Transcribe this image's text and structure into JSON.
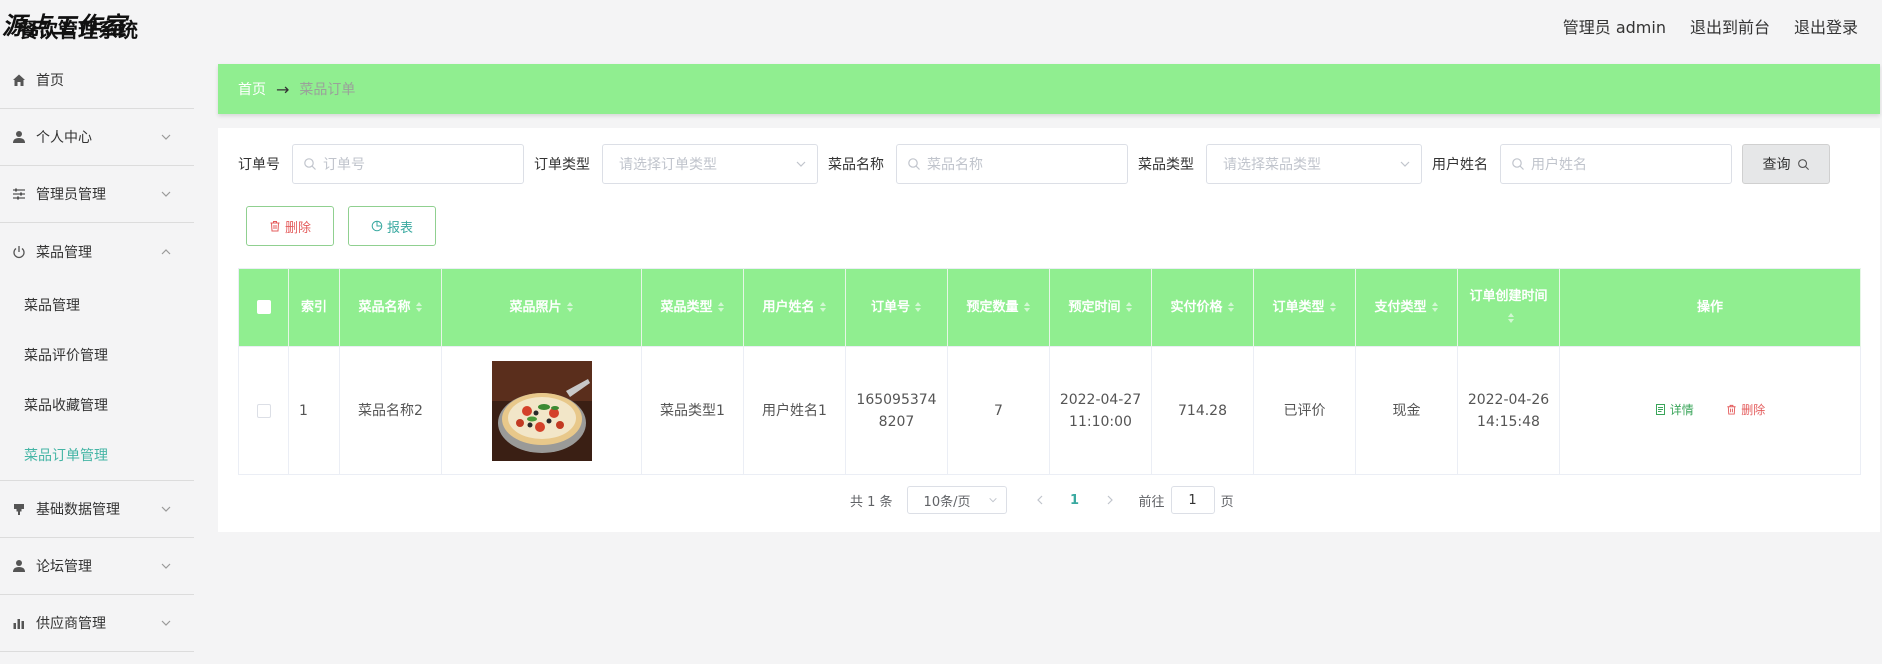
{
  "header": {
    "watermark": "源点工作室",
    "system_title": "餐饮管理系统",
    "user_label": "管理员 admin",
    "frontend_link": "退出到前台",
    "logout_link": "退出登录"
  },
  "sidebar": {
    "items": [
      {
        "label": "首页",
        "icon": "home-icon"
      },
      {
        "label": "个人中心",
        "icon": "user-icon"
      },
      {
        "label": "管理员管理",
        "icon": "sliders-icon"
      },
      {
        "label": "菜品管理",
        "icon": "power-icon"
      },
      {
        "label": "基础数据管理",
        "icon": "stamp-icon"
      },
      {
        "label": "论坛管理",
        "icon": "user-icon"
      },
      {
        "label": "供应商管理",
        "icon": "bar-chart-icon"
      }
    ],
    "sub_items": [
      "菜品管理",
      "菜品评价管理",
      "菜品收藏管理",
      "菜品订单管理"
    ],
    "active_sub": "菜品订单管理"
  },
  "breadcrumb": {
    "home": "首页",
    "arrow": "→",
    "current": "菜品订单"
  },
  "search": {
    "order_no_label": "订单号",
    "order_no_placeholder": "订单号",
    "order_type_label": "订单类型",
    "order_type_placeholder": "请选择订单类型",
    "dish_name_label": "菜品名称",
    "dish_name_placeholder": "菜品名称",
    "dish_type_label": "菜品类型",
    "dish_type_placeholder": "请选择菜品类型",
    "user_name_label": "用户姓名",
    "user_name_placeholder": "用户姓名",
    "query_button": "查询"
  },
  "actions": {
    "delete_button": "删除",
    "report_button": "报表"
  },
  "table": {
    "columns": [
      "索引",
      "菜品名称",
      "菜品照片",
      "菜品类型",
      "用户姓名",
      "订单号",
      "预定数量",
      "预定时间",
      "实付价格",
      "订单类型",
      "支付类型",
      "订单创建时间",
      "操作"
    ],
    "rows": [
      {
        "index": "1",
        "dish_name": "菜品名称2",
        "dish_type": "菜品类型1",
        "user_name": "用户姓名1",
        "order_no_line1": "165095374",
        "order_no_line2": "8207",
        "quantity": "7",
        "reserve_date": "2022-04-27",
        "reserve_time": "11:10:00",
        "price": "714.28",
        "order_type": "已评价",
        "pay_type": "现金",
        "create_date": "2022-04-26",
        "create_time": "14:15:48",
        "detail_label": "详情",
        "delete_label": "删除"
      }
    ]
  },
  "pagination": {
    "total": "共 1 条",
    "page_size": "10条/页",
    "current_page": "1",
    "goto_label": "前往",
    "goto_value": "1",
    "page_suffix": "页"
  },
  "colors": {
    "accent_green": "#90ee90",
    "active_teal": "#45b5a5",
    "danger_red": "#e45c5c"
  }
}
